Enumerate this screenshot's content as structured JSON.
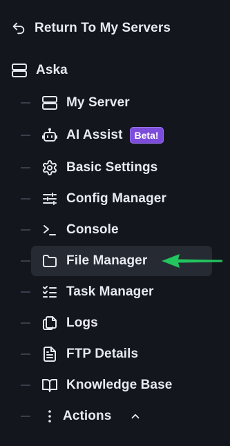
{
  "nav": {
    "return_label": "Return To My Servers",
    "server_name": "Aska",
    "items": [
      {
        "label": "My Server",
        "icon": "server-icon"
      },
      {
        "label": "AI Assist",
        "icon": "robot-icon",
        "badge": "Beta!"
      },
      {
        "label": "Basic Settings",
        "icon": "gear-icon"
      },
      {
        "label": "Config Manager",
        "icon": "sliders-icon"
      },
      {
        "label": "Console",
        "icon": "terminal-icon"
      },
      {
        "label": "File Manager",
        "icon": "folder-icon",
        "active": true
      },
      {
        "label": "Task Manager",
        "icon": "checklist-icon"
      },
      {
        "label": "Logs",
        "icon": "copy-icon"
      },
      {
        "label": "FTP Details",
        "icon": "file-text-icon"
      },
      {
        "label": "Knowledge Base",
        "icon": "book-icon"
      },
      {
        "label": "Actions",
        "icon": "dots-vertical-icon"
      }
    ]
  },
  "colors": {
    "background": "#14161e",
    "active_item": "#262a33",
    "badge": "#7c4ddb",
    "arrow": "#22c55e"
  }
}
